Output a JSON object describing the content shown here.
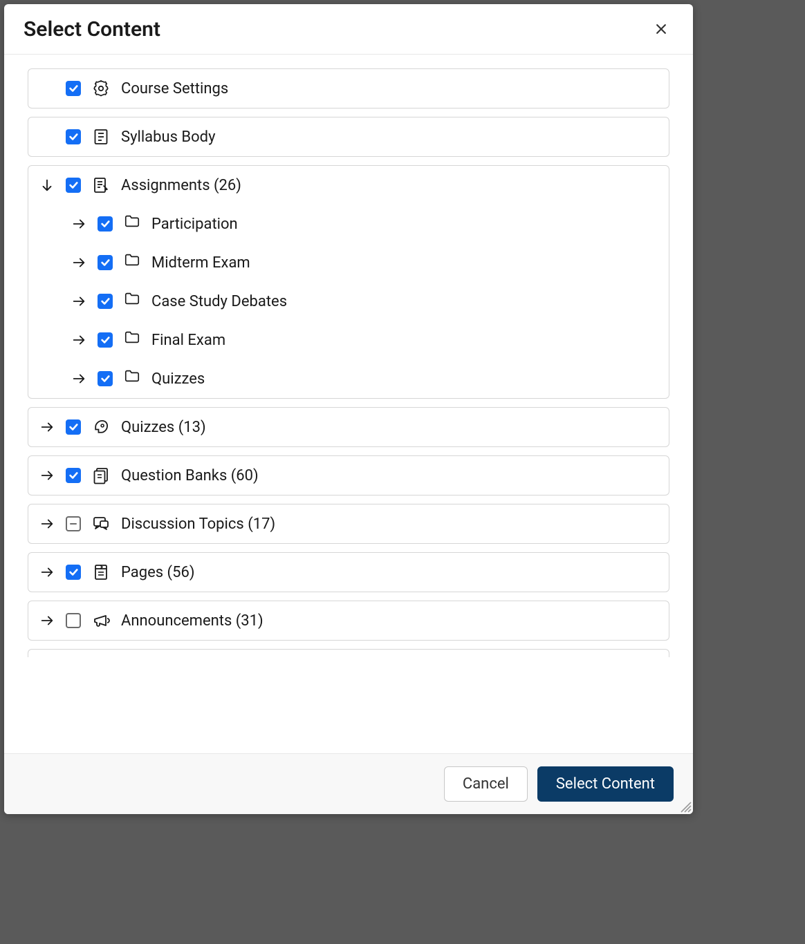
{
  "modal": {
    "title": "Select Content",
    "cancel_label": "Cancel",
    "submit_label": "Select Content"
  },
  "items": [
    {
      "icon": "settings",
      "label": "Course Settings",
      "state": "checked",
      "expand": "none"
    },
    {
      "icon": "syllabus",
      "label": "Syllabus Body",
      "state": "checked",
      "expand": "none"
    },
    {
      "icon": "assignments",
      "label": "Assignments (26)",
      "state": "checked",
      "expand": "down",
      "children": [
        {
          "label": "Participation",
          "state": "checked"
        },
        {
          "label": "Midterm Exam",
          "state": "checked"
        },
        {
          "label": "Case Study Debates",
          "state": "checked"
        },
        {
          "label": "Final Exam",
          "state": "checked"
        },
        {
          "label": "Quizzes",
          "state": "checked"
        }
      ]
    },
    {
      "icon": "rocket",
      "label": "Quizzes (13)",
      "state": "checked",
      "expand": "right"
    },
    {
      "icon": "questionbank",
      "label": "Question Banks (60)",
      "state": "checked",
      "expand": "right"
    },
    {
      "icon": "discussion",
      "label": "Discussion Topics (17)",
      "state": "indeterminate",
      "expand": "right"
    },
    {
      "icon": "pages",
      "label": "Pages (56)",
      "state": "checked",
      "expand": "right"
    },
    {
      "icon": "announce",
      "label": "Announcements (31)",
      "state": "unchecked",
      "expand": "right"
    }
  ]
}
